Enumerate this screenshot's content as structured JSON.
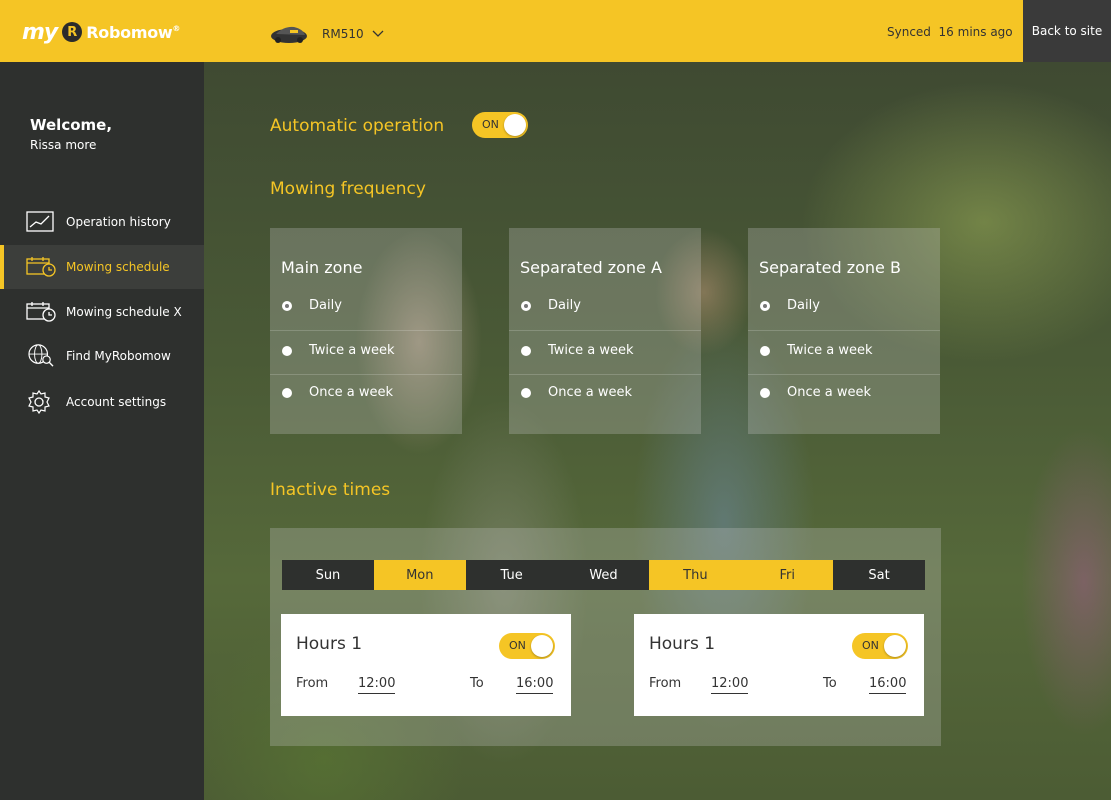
{
  "header": {
    "logo_my": "my",
    "logo_badge": "R",
    "logo_name": "Robomow",
    "logo_mark": "®",
    "model": "RM510",
    "synced": "Synced  16 mins ago",
    "back_label": "Back to site"
  },
  "sidebar": {
    "welcome": "Welcome,",
    "username": "Rissa more",
    "items": [
      {
        "label": "Operation history",
        "icon": "chart-icon"
      },
      {
        "label": "Mowing schedule",
        "icon": "calendar-clock-icon",
        "active": true
      },
      {
        "label": "Mowing schedule X",
        "icon": "calendar-clock-icon"
      },
      {
        "label": "Find MyRobomow",
        "icon": "globe-search-icon"
      },
      {
        "label": "Account settings",
        "icon": "gear-icon"
      }
    ]
  },
  "main": {
    "automatic_title": "Automatic operation",
    "automatic_toggle": "ON",
    "frequency_title": "Mowing frequency",
    "zones": [
      {
        "title": "Main zone",
        "options": [
          "Daily",
          "Twice a week",
          "Once a week"
        ],
        "selected": 0
      },
      {
        "title": "Separated zone A",
        "options": [
          "Daily",
          "Twice a week",
          "Once a week"
        ],
        "selected": 0
      },
      {
        "title": "Separated zone B",
        "options": [
          "Daily",
          "Twice a week",
          "Once a week"
        ],
        "selected": 0
      }
    ],
    "inactive_title": "Inactive times",
    "days": [
      {
        "label": "Sun",
        "on": false
      },
      {
        "label": "Mon",
        "on": true
      },
      {
        "label": "Tue",
        "on": false
      },
      {
        "label": "Wed",
        "on": false
      },
      {
        "label": "Thu",
        "on": true
      },
      {
        "label": "Fri",
        "on": true
      },
      {
        "label": "Sat",
        "on": false
      }
    ],
    "hours": [
      {
        "title": "Hours 1",
        "toggle": "ON",
        "from_label": "From",
        "from": "12:00",
        "to_label": "To",
        "to": "16:00"
      },
      {
        "title": "Hours 1",
        "toggle": "ON",
        "from_label": "From",
        "from": "12:00",
        "to_label": "To",
        "to": "16:00"
      }
    ]
  },
  "colors": {
    "accent": "#f5c525",
    "sidebar": "#2e302e"
  }
}
